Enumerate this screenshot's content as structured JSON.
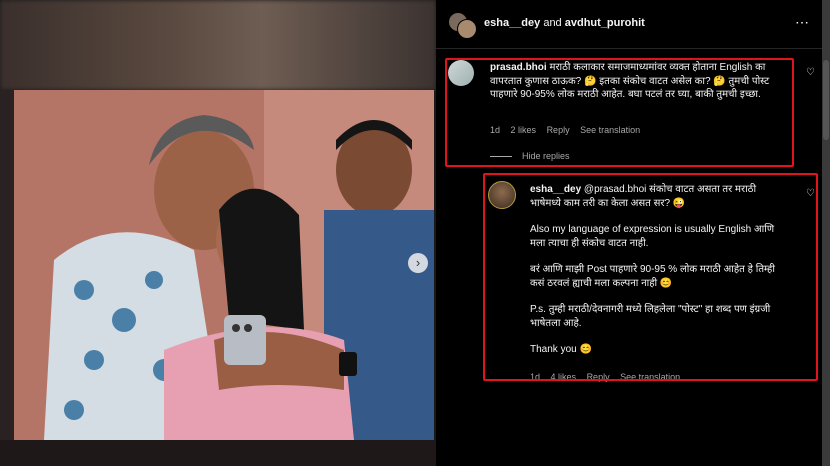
{
  "header": {
    "user1": "esha__dey",
    "and_text": " and ",
    "user2": "avdhut_purohit",
    "more_icon": "⋯"
  },
  "comment1": {
    "username": "prasad.bhoi",
    "text": " मराठी कलाकार समाजमाध्यमांवर व्यक्त होताना English का वापरतात कुणास ठाऊक? 🤔 इतका संकोच वाटत असेल का? 🤔 तुमची पोस्ट पाहणारे 90-95% लोक मराठी आहेत. बघा पटलं तर घ्या, बाकी तुमची इच्छा.",
    "time": "1d",
    "likes": "2 likes",
    "reply": "Reply",
    "see_translation": "See translation",
    "hide_replies": "Hide replies"
  },
  "comment2": {
    "username": "esha__dey",
    "mention": " @prasad.bhoi",
    "line1": " संकोच वाटत असता तर मराठी भाषेमध्ये काम तरी का केला असत सर? 😜",
    "para2": "Also my language of expression is usually English आणि मला त्याचा ही संकोच वाटत नाही.",
    "para3": "बरं आणि माझी Post पाहणारे 90-95 % लोक मराठी आहेत हे तिम्ही कसं ठरवलं ह्याची मला कल्पना नाही 😊",
    "para4": "P.s. तुम्ही मराठी/देवनागरी मध्ये लिहलेला \"पोस्ट\" हा शब्द पण इंग्रजी भाषेतला आहे.",
    "para5": "Thank you 😊",
    "time": "1d",
    "likes": "4 likes",
    "reply": "Reply",
    "see_translation": "See translation"
  },
  "photo": {
    "next_arrow": "›"
  },
  "colors": {
    "highlight": "#e1131b",
    "background": "#000000",
    "text": "#f5f5f5",
    "muted": "#a8a8a8"
  }
}
